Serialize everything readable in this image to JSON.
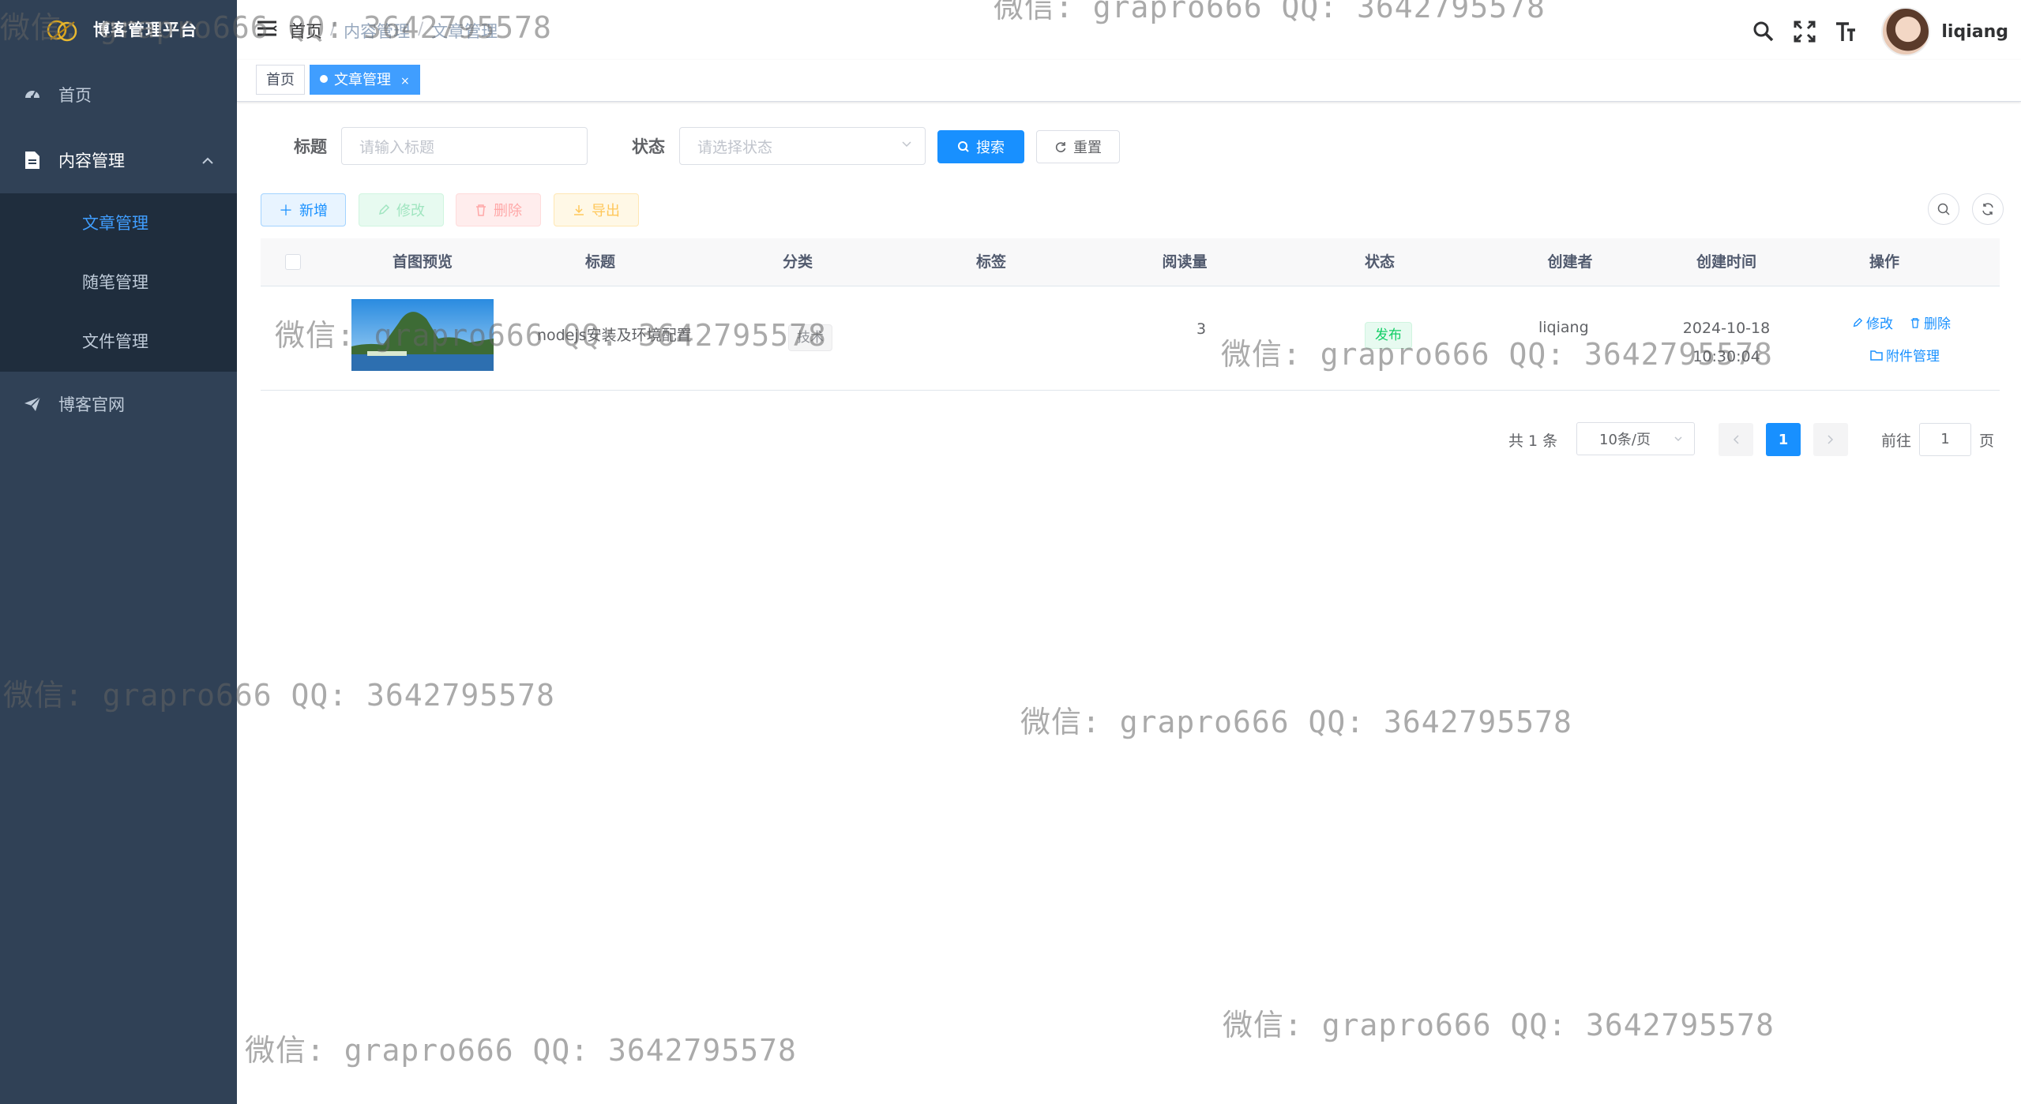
{
  "sidebar": {
    "title": "博客管理平台",
    "menu": [
      {
        "label": "首页",
        "icon": "dashboard-icon"
      },
      {
        "label": "内容管理",
        "icon": "document-icon"
      },
      {
        "label": "博客官网",
        "icon": "paper-plane-icon"
      }
    ],
    "submenu": [
      {
        "label": "文章管理"
      },
      {
        "label": "随笔管理"
      },
      {
        "label": "文件管理"
      }
    ]
  },
  "navbar": {
    "breadcrumb": [
      "首页",
      "内容管理",
      "文章管理"
    ],
    "username": "liqiang"
  },
  "tags": {
    "home": "首页",
    "current": "文章管理",
    "close": "×"
  },
  "search": {
    "title_label": "标题",
    "title_placeholder": "请输入标题",
    "status_label": "状态",
    "status_placeholder": "请选择状态",
    "search_btn": "搜索",
    "reset_btn": "重置"
  },
  "toolbar": {
    "add": "新增",
    "edit": "修改",
    "delete": "删除",
    "export": "导出"
  },
  "table": {
    "columns": [
      "首图预览",
      "标题",
      "分类",
      "标签",
      "阅读量",
      "状态",
      "创建者",
      "创建时间",
      "操作"
    ],
    "rows": [
      {
        "title": "nodejs安装及环境配置",
        "category": "技术",
        "tags": "",
        "reads": "3",
        "status": "发布",
        "creator": "liqiang",
        "date": "2024-10-18",
        "time": "10:30:04",
        "op_edit": "修改",
        "op_delete": "删除",
        "op_attach": "附件管理"
      }
    ]
  },
  "pagination": {
    "total": "共 1 条",
    "page_size": "10条/页",
    "current": "1",
    "goto_prefix": "前往",
    "goto_value": "1",
    "goto_suffix": "页"
  },
  "watermark": "微信: grapro666 QQ: 3642795578",
  "colors": {
    "sidebar_bg": "#304156",
    "submenu_bg": "#1f2d3d",
    "primary": "#1890ff",
    "success": "#13ce66"
  }
}
